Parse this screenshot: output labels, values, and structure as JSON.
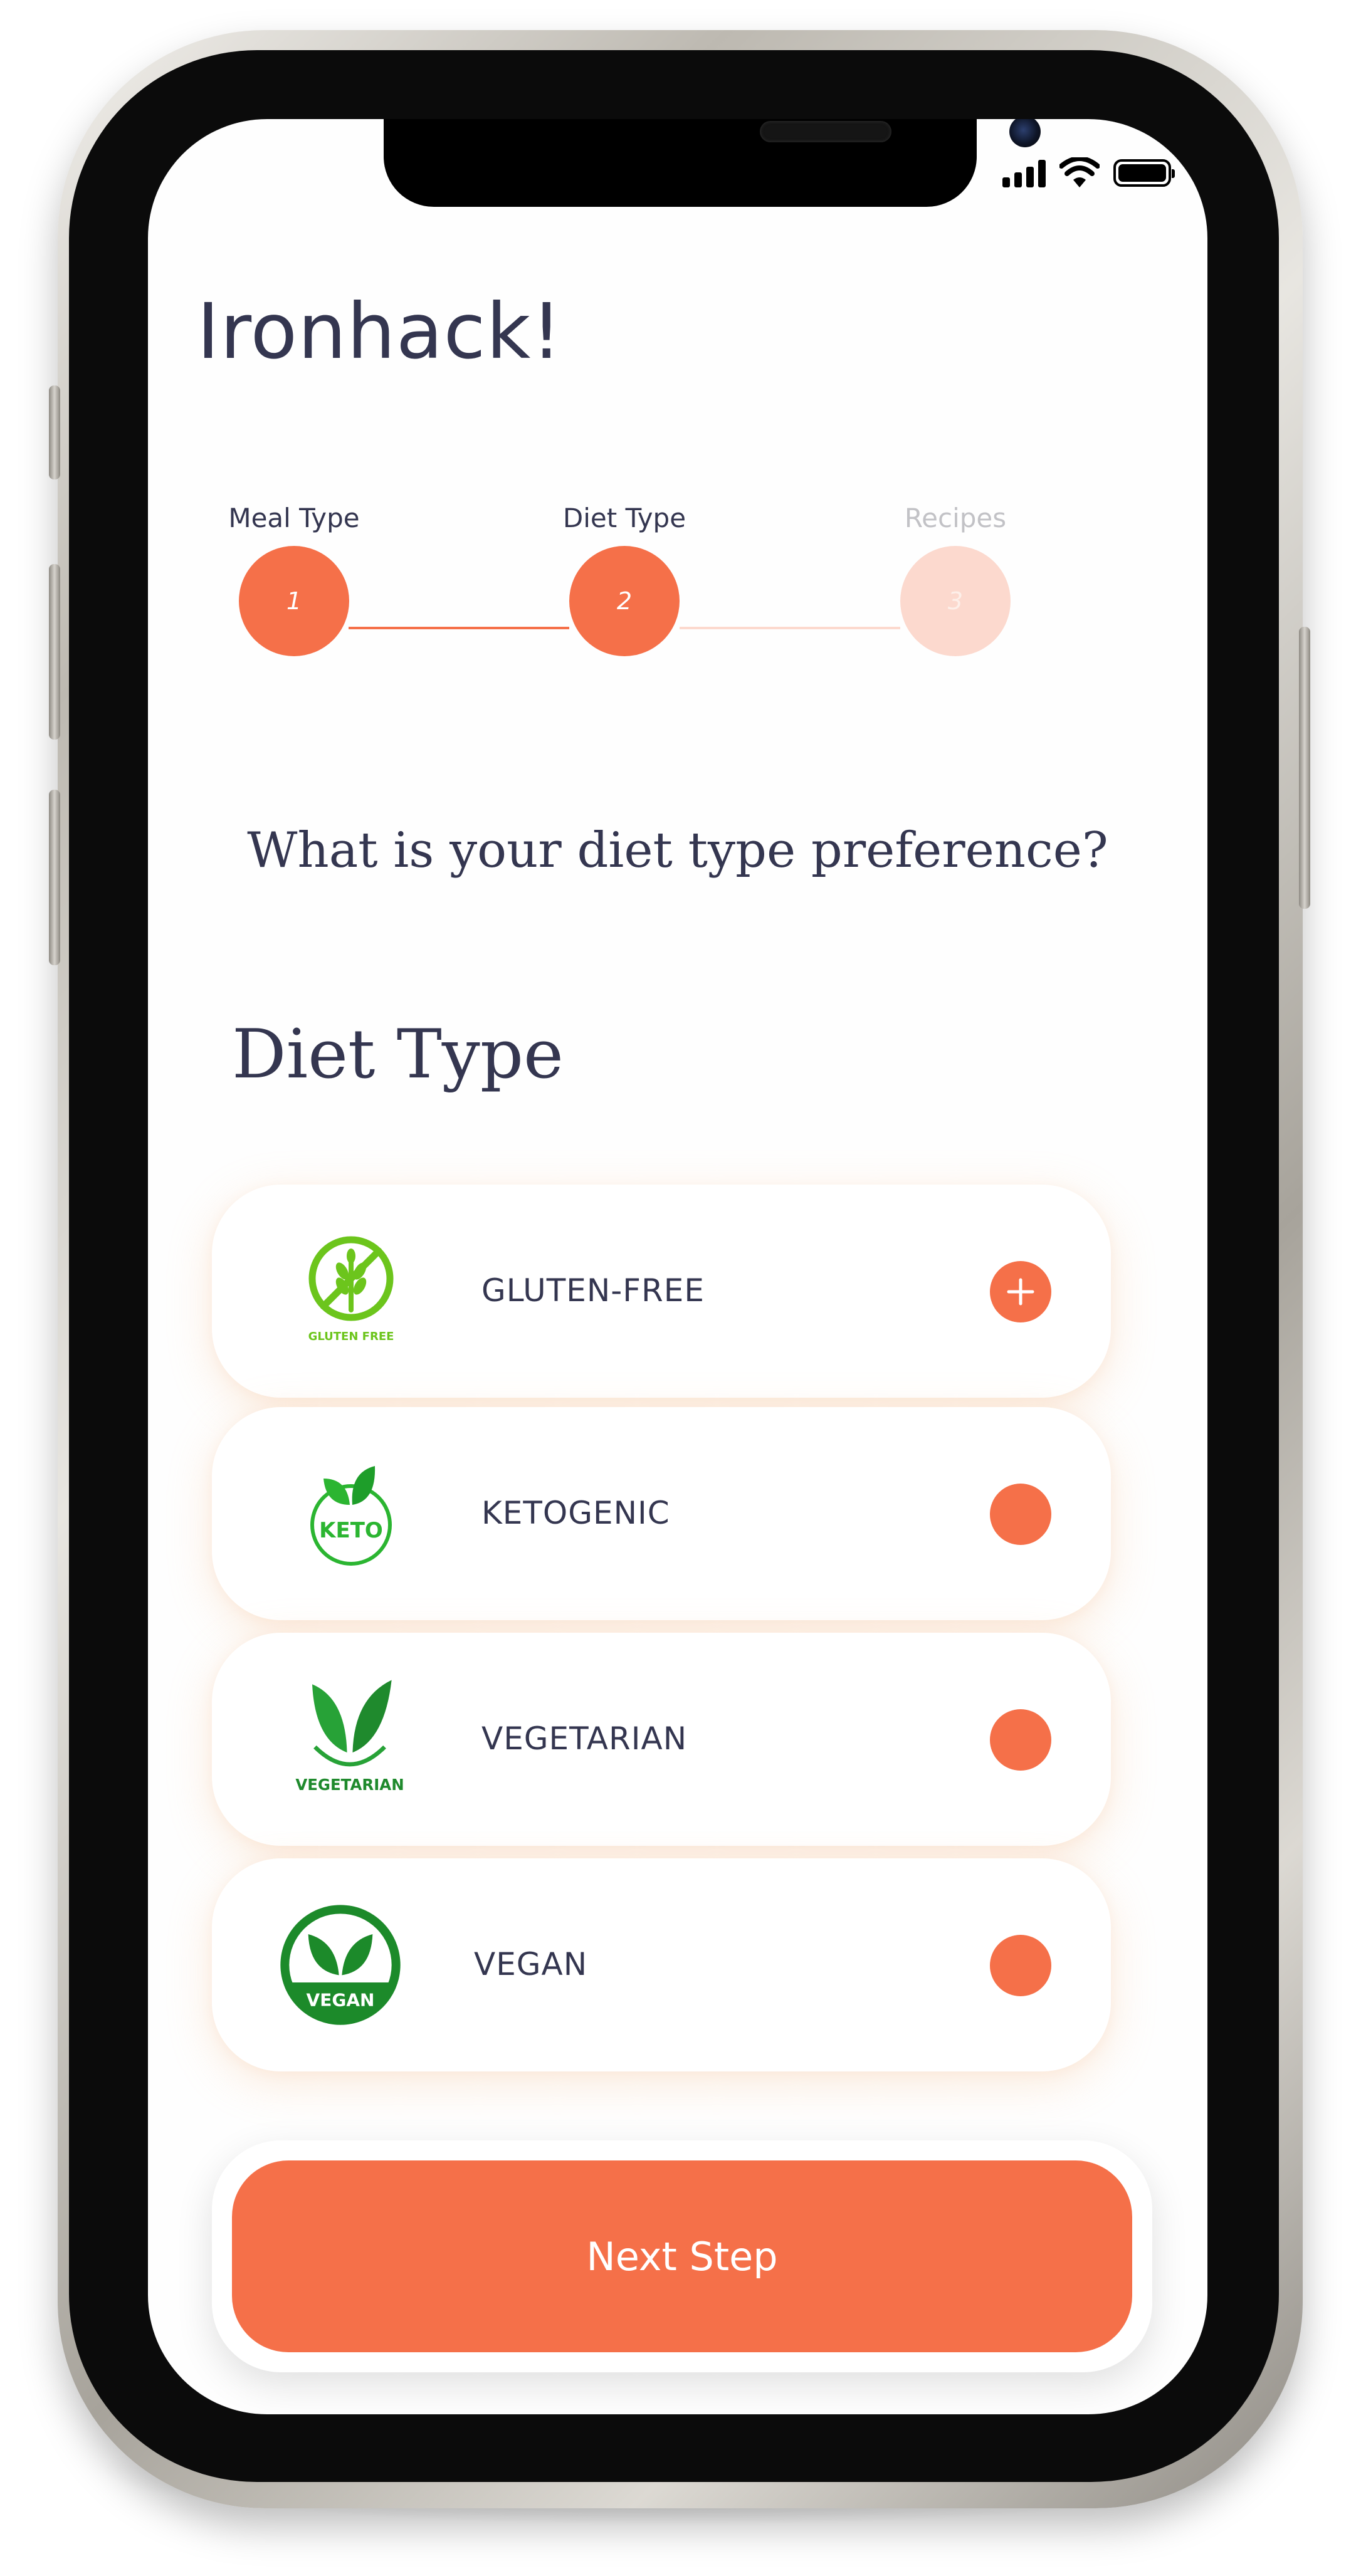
{
  "app": {
    "title": "Ironhack!"
  },
  "steps": [
    {
      "label": "Meal Type",
      "number": "1",
      "state": "complete"
    },
    {
      "label": "Diet Type",
      "number": "2",
      "state": "active"
    },
    {
      "label": "Recipes",
      "number": "3",
      "state": "upcoming"
    }
  ],
  "question": "What is your diet type preference?",
  "section_title": "Diet Type",
  "diet_options": [
    {
      "label": "GLUTEN-FREE",
      "icon": "gluten-free-icon",
      "badge_text": "GLUTEN FREE",
      "toggle": "plus-icon"
    },
    {
      "label": "KETOGENIC",
      "icon": "keto-icon",
      "badge_text": "KETO",
      "toggle": "empty"
    },
    {
      "label": "VEGETARIAN",
      "icon": "vegetarian-icon",
      "badge_text": "VEGETARIAN",
      "toggle": "empty"
    },
    {
      "label": "VEGAN",
      "icon": "vegan-icon",
      "badge_text": "VEGAN",
      "toggle": "empty"
    }
  ],
  "next_button": {
    "label": "Next Step"
  },
  "colors": {
    "accent": "#f57049",
    "accent_muted": "#fcd9ce",
    "text_dark": "#343650",
    "text_muted": "#c2c2c6",
    "green_light": "#6cc51c",
    "green_dark": "#1c8a2a"
  }
}
